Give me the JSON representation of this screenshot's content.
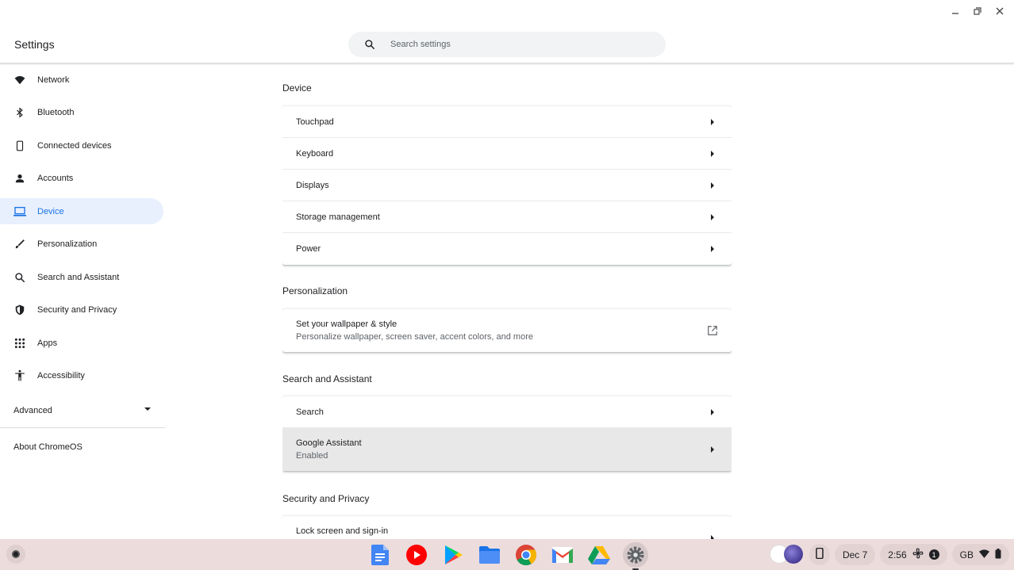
{
  "header": {
    "app_title": "Settings",
    "search_placeholder": "Search settings"
  },
  "sidebar": {
    "items": [
      {
        "label": "Network",
        "icon": "wifi-icon"
      },
      {
        "label": "Bluetooth",
        "icon": "bluetooth-icon"
      },
      {
        "label": "Connected devices",
        "icon": "phone-icon"
      },
      {
        "label": "Accounts",
        "icon": "person-icon"
      },
      {
        "label": "Device",
        "icon": "laptop-icon",
        "active": true
      },
      {
        "label": "Personalization",
        "icon": "brush-icon"
      },
      {
        "label": "Search and Assistant",
        "icon": "search-icon"
      },
      {
        "label": "Security and Privacy",
        "icon": "shield-icon"
      },
      {
        "label": "Apps",
        "icon": "apps-grid-icon"
      },
      {
        "label": "Accessibility",
        "icon": "accessibility-icon"
      }
    ],
    "advanced_label": "Advanced",
    "about_label": "About ChromeOS"
  },
  "main": {
    "device": {
      "title": "Device",
      "rows": [
        "Touchpad",
        "Keyboard",
        "Displays",
        "Storage management",
        "Power"
      ]
    },
    "personalization": {
      "title": "Personalization",
      "wallpaper_title": "Set your wallpaper & style",
      "wallpaper_sub": "Personalize wallpaper, screen saver, accent colors, and more"
    },
    "search_assistant": {
      "title": "Search and Assistant",
      "search_label": "Search",
      "assistant_label": "Google Assistant",
      "assistant_status": "Enabled"
    },
    "security": {
      "title": "Security and Privacy",
      "lock_label": "Lock screen and sign-in"
    }
  },
  "shelf": {
    "apps": [
      "docs-icon",
      "youtube-icon",
      "play-store-icon",
      "files-icon",
      "chrome-icon",
      "gmail-icon",
      "drive-icon",
      "settings-icon"
    ],
    "date": "Dec 7",
    "time": "2:56",
    "notification_count": "1",
    "keyboard_layout": "GB"
  },
  "colors": {
    "accent": "#1a73e8",
    "active_bg": "#e8f0fe",
    "shelf_bg": "#ecdcdc"
  }
}
